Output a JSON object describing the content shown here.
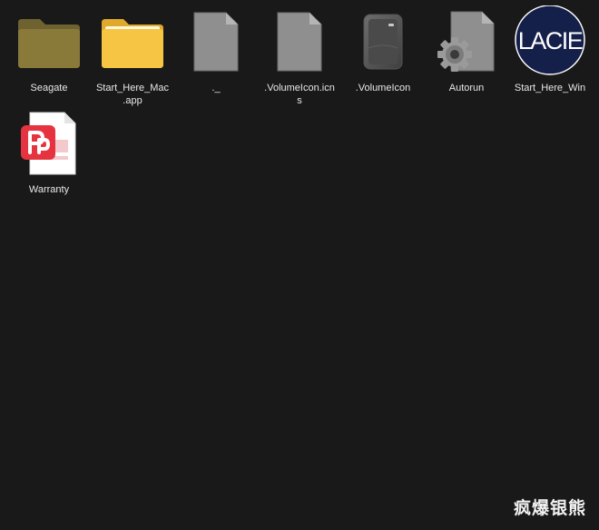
{
  "desktop": {
    "items": [
      {
        "label": "Seagate",
        "icon": "folder-icon",
        "kind": "folder-dark"
      },
      {
        "label": "Start_Here_Mac\n.app",
        "icon": "folder-icon",
        "kind": "folder-yellow"
      },
      {
        "label": "._",
        "icon": "file-icon",
        "kind": "file"
      },
      {
        "label": ".VolumeIcon.icn\ns",
        "icon": "file-icon",
        "kind": "file"
      },
      {
        "label": ".VolumeIcon",
        "icon": "external-drive-icon",
        "kind": "drive"
      },
      {
        "label": "Autorun",
        "icon": "settings-file-icon",
        "kind": "settings-file"
      },
      {
        "label": "Start_Here_Win",
        "icon": "lacie-logo-icon",
        "kind": "lacie",
        "logo_text": "LACIE"
      },
      {
        "label": "Warranty",
        "icon": "pdf-document-icon",
        "kind": "pdf"
      }
    ]
  },
  "watermark": {
    "text": "疯爆银熊"
  },
  "colors": {
    "background": "#191919",
    "folder_dark": "#8a7a3a",
    "folder_yellow": "#f5c543",
    "file_gray": "#8f8f8f",
    "lacie_navy": "#15204a",
    "pdf_red": "#e5343f"
  }
}
